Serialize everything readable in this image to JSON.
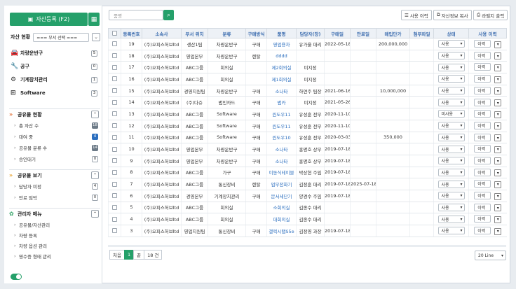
{
  "sidebar": {
    "register_label": "자산등록 (F2)",
    "asset_status_label": "자산 현황",
    "dept_select": "=== 부서 선택 ===",
    "categories": [
      {
        "label": "차량운반구",
        "count": "5",
        "icon": "car-icon"
      },
      {
        "label": "공구",
        "count": "0",
        "icon": "wrench-icon"
      },
      {
        "label": "기계장치관리",
        "count": "1",
        "icon": "gear-icon"
      },
      {
        "label": "Software",
        "count": "3",
        "icon": "windows-icon"
      }
    ],
    "sections": [
      {
        "title": "공유물 현황",
        "items": [
          {
            "label": "총 자산 수",
            "count": "18"
          },
          {
            "label": "대여 중",
            "count": "4"
          },
          {
            "label": "공유물 분류 수",
            "count": "14"
          },
          {
            "label": "승인대기",
            "count": "0"
          }
        ]
      },
      {
        "title": "공유물 보기",
        "items": [
          {
            "label": "담당자 미정",
            "count": "4"
          },
          {
            "label": "만료 임박",
            "count": "0"
          }
        ]
      },
      {
        "title": "관리자 메뉴",
        "items": [
          {
            "label": "공유물/자산관리"
          },
          {
            "label": "차량 등록"
          },
          {
            "label": "차량 옵션 관리"
          },
          {
            "label": "영수증 형태 관리"
          }
        ]
      }
    ]
  },
  "toolbar": {
    "search_placeholder": "품명",
    "usage_history": "사용 이력",
    "copy_asset": "자산정보 복사",
    "print_label": "라벨지 출력"
  },
  "table": {
    "headers": [
      "",
      "등록번호",
      "소속사",
      "부서 위치",
      "분류",
      "구매방식",
      "품명",
      "담당자(장)",
      "구매일",
      "만료일",
      "매입단가",
      "첨부파일",
      "상태",
      "사용 이력"
    ],
    "rows": [
      {
        "no": "19",
        "company": "(주)오피스허브ltd",
        "dept": "생산1팀",
        "cat": "차량운반구",
        "buy": "구매",
        "name": "영업용차",
        "owner": "유가울 대리",
        "date": "2022-05-18",
        "exp": "",
        "price": "200,000,000",
        "status": "사용"
      },
      {
        "no": "18",
        "company": "(주)오피스허브ltd",
        "dept": "영업본부",
        "cat": "차량운반구",
        "buy": "렌탈",
        "name": "dddd",
        "owner": "",
        "date": "",
        "exp": "",
        "price": "",
        "status": "사용"
      },
      {
        "no": "17",
        "company": "(주)오피스허브ltd",
        "dept": "ABC그룹",
        "cat": "회의실",
        "buy": "",
        "name": "제2회의실",
        "owner": "미지정",
        "date": "",
        "exp": "",
        "price": "",
        "status": "사용"
      },
      {
        "no": "16",
        "company": "(주)오피스허브ltd",
        "dept": "ABC그룹",
        "cat": "회의실",
        "buy": "",
        "name": "제1회의실",
        "owner": "미지정",
        "date": "",
        "exp": "",
        "price": "",
        "status": "사용"
      },
      {
        "no": "15",
        "company": "(주)오피스허브ltd",
        "dept": "경영지원팀",
        "cat": "차량운반구",
        "buy": "구매",
        "name": "소나타",
        "owner": "하연주 팀장",
        "date": "2021-06-16",
        "exp": "",
        "price": "10,000,000",
        "status": "사용"
      },
      {
        "no": "14",
        "company": "(주)오피스허브ltd",
        "dept": "(주)다쥬",
        "cat": "법인카드",
        "buy": "구매",
        "name": "법카",
        "owner": "미지정",
        "date": "2021-05-26",
        "exp": "",
        "price": "",
        "status": "사용"
      },
      {
        "no": "13",
        "company": "(주)오피스허브ltd",
        "dept": "ABC그룹",
        "cat": "Software",
        "buy": "구매",
        "name": "윈도우11",
        "owner": "유성훈 전무",
        "date": "2020-11-10",
        "exp": "",
        "price": "",
        "status": "미사용"
      },
      {
        "no": "12",
        "company": "(주)오피스허브ltd",
        "dept": "ABC그룹",
        "cat": "Software",
        "buy": "구매",
        "name": "윈도우11",
        "owner": "유성훈 전무",
        "date": "2020-11-10",
        "exp": "",
        "price": "",
        "status": "사용"
      },
      {
        "no": "11",
        "company": "(주)오피스허브ltd",
        "dept": "ABC그룹",
        "cat": "Software",
        "buy": "구매",
        "name": "윈도우10",
        "owner": "유성훈 전무",
        "date": "2020-03-03",
        "exp": "",
        "price": "350,000",
        "status": "사용"
      },
      {
        "no": "10",
        "company": "(주)오피스허브ltd",
        "dept": "영업본부",
        "cat": "차량운반구",
        "buy": "구매",
        "name": "소나타",
        "owner": "홍명호 상무",
        "date": "2019-07-18",
        "exp": "",
        "price": "",
        "status": "사용"
      },
      {
        "no": "9",
        "company": "(주)오피스허브ltd",
        "dept": "영업본부",
        "cat": "차량운반구",
        "buy": "구매",
        "name": "소나타",
        "owner": "홍명호 상무",
        "date": "2019-07-18",
        "exp": "",
        "price": "",
        "status": "사용"
      },
      {
        "no": "8",
        "company": "(주)오피스허브ltd",
        "dept": "ABC그룹",
        "cat": "가구",
        "buy": "구매",
        "name": "이동식테이블",
        "owner": "박상현 주임",
        "date": "2019-07-18",
        "exp": "",
        "price": "",
        "status": "사용"
      },
      {
        "no": "7",
        "company": "(주)오피스허브ltd",
        "dept": "ABC그룹",
        "cat": "통신장비",
        "buy": "렌탈",
        "name": "업무전화기",
        "owner": "김정훈 대리",
        "date": "2019-07-18",
        "exp": "2025-07-18",
        "price": "",
        "status": "사용"
      },
      {
        "no": "6",
        "company": "(주)오피스허브ltd",
        "dept": "경영본부",
        "cat": "기계장치관리",
        "buy": "구매",
        "name": "문서세단기",
        "owner": "양경수 주임",
        "date": "2019-07-18",
        "exp": "",
        "price": "",
        "status": "사용"
      },
      {
        "no": "5",
        "company": "(주)오피스허브ltd",
        "dept": "ABC그룹",
        "cat": "회의실",
        "buy": "",
        "name": "소회의실",
        "owner": "김종수 대리",
        "date": "",
        "exp": "",
        "price": "",
        "status": "사용"
      },
      {
        "no": "4",
        "company": "(주)오피스허브ltd",
        "dept": "ABC그룹",
        "cat": "회의실",
        "buy": "",
        "name": "대회의실",
        "owner": "김종수 대리",
        "date": "",
        "exp": "",
        "price": "",
        "status": "사용"
      },
      {
        "no": "3",
        "company": "(주)오피스허브ltd",
        "dept": "영업지원팀",
        "cat": "통신장비",
        "buy": "구매",
        "name": "갤럭시탭S5e",
        "owner": "김정영 과장",
        "date": "2019-07-18",
        "exp": "",
        "price": "",
        "status": "사용"
      }
    ],
    "history_label": "이력"
  },
  "pager": {
    "first": "처음",
    "current": "1",
    "last": "끝",
    "total": "18 건"
  },
  "lines_select": "20 Line"
}
